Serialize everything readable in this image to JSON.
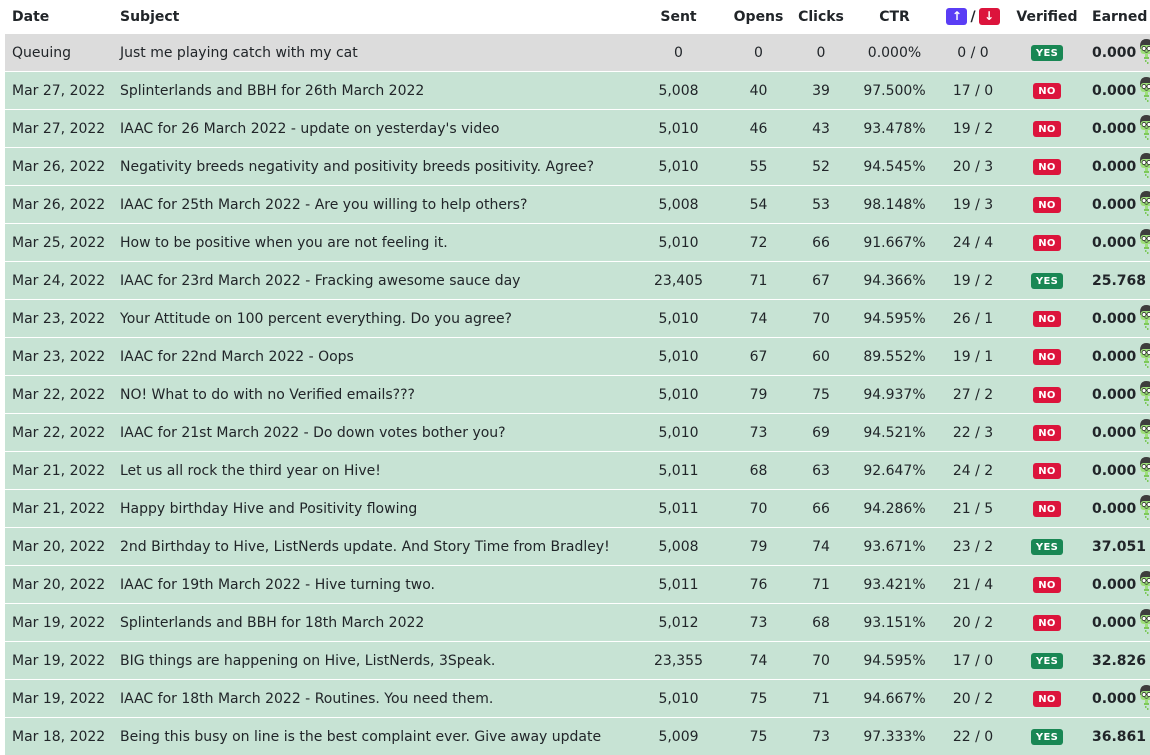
{
  "table": {
    "headers": {
      "date": "Date",
      "subject": "Subject",
      "sent": "Sent",
      "opens": "Opens",
      "clicks": "Clicks",
      "ctr": "CTR",
      "votes_sep": "/",
      "verified": "Verified",
      "earned": "Earned"
    },
    "rows": [
      {
        "status": "queued",
        "date": "Queuing",
        "subject": "Just me playing catch with my cat",
        "sent": "0",
        "opens": "0",
        "clicks": "0",
        "ctr": "0.000%",
        "votes": "0 / 0",
        "verified": "YES",
        "earned": "0.000"
      },
      {
        "status": "sent",
        "date": "Mar 27, 2022",
        "subject": "Splinterlands and BBH for 26th March 2022",
        "sent": "5,008",
        "opens": "40",
        "clicks": "39",
        "ctr": "97.500%",
        "votes": "17 / 0",
        "verified": "NO",
        "earned": "0.000"
      },
      {
        "status": "sent",
        "date": "Mar 27, 2022",
        "subject": "IAAC for 26 March 2022 - update on yesterday's video",
        "sent": "5,010",
        "opens": "46",
        "clicks": "43",
        "ctr": "93.478%",
        "votes": "19 / 2",
        "verified": "NO",
        "earned": "0.000"
      },
      {
        "status": "sent",
        "date": "Mar 26, 2022",
        "subject": "Negativity breeds negativity and positivity breeds positivity. Agree?",
        "sent": "5,010",
        "opens": "55",
        "clicks": "52",
        "ctr": "94.545%",
        "votes": "20 / 3",
        "verified": "NO",
        "earned": "0.000"
      },
      {
        "status": "sent",
        "date": "Mar 26, 2022",
        "subject": "IAAC for 25th March 2022 - Are you willing to help others?",
        "sent": "5,008",
        "opens": "54",
        "clicks": "53",
        "ctr": "98.148%",
        "votes": "19 / 3",
        "verified": "NO",
        "earned": "0.000"
      },
      {
        "status": "sent",
        "date": "Mar 25, 2022",
        "subject": "How to be positive when you are not feeling it.",
        "sent": "5,010",
        "opens": "72",
        "clicks": "66",
        "ctr": "91.667%",
        "votes": "24 / 4",
        "verified": "NO",
        "earned": "0.000"
      },
      {
        "status": "sent",
        "date": "Mar 24, 2022",
        "subject": "IAAC for 23rd March 2022 - Fracking awesome sauce day",
        "sent": "23,405",
        "opens": "71",
        "clicks": "67",
        "ctr": "94.366%",
        "votes": "19 / 2",
        "verified": "YES",
        "earned": "25.768"
      },
      {
        "status": "sent",
        "date": "Mar 23, 2022",
        "subject": "Your Attitude on 100 percent everything. Do you agree?",
        "sent": "5,010",
        "opens": "74",
        "clicks": "70",
        "ctr": "94.595%",
        "votes": "26 / 1",
        "verified": "NO",
        "earned": "0.000"
      },
      {
        "status": "sent",
        "date": "Mar 23, 2022",
        "subject": "IAAC for 22nd March 2022 - Oops",
        "sent": "5,010",
        "opens": "67",
        "clicks": "60",
        "ctr": "89.552%",
        "votes": "19 / 1",
        "verified": "NO",
        "earned": "0.000"
      },
      {
        "status": "sent",
        "date": "Mar 22, 2022",
        "subject": "NO! What to do with no Verified emails???",
        "sent": "5,010",
        "opens": "79",
        "clicks": "75",
        "ctr": "94.937%",
        "votes": "27 / 2",
        "verified": "NO",
        "earned": "0.000"
      },
      {
        "status": "sent",
        "date": "Mar 22, 2022",
        "subject": "IAAC for 21st March 2022 - Do down votes bother you?",
        "sent": "5,010",
        "opens": "73",
        "clicks": "69",
        "ctr": "94.521%",
        "votes": "22 / 3",
        "verified": "NO",
        "earned": "0.000"
      },
      {
        "status": "sent",
        "date": "Mar 21, 2022",
        "subject": "Let us all rock the third year on Hive!",
        "sent": "5,011",
        "opens": "68",
        "clicks": "63",
        "ctr": "92.647%",
        "votes": "24 / 2",
        "verified": "NO",
        "earned": "0.000"
      },
      {
        "status": "sent",
        "date": "Mar 21, 2022",
        "subject": "Happy birthday Hive and Positivity flowing",
        "sent": "5,011",
        "opens": "70",
        "clicks": "66",
        "ctr": "94.286%",
        "votes": "21 / 5",
        "verified": "NO",
        "earned": "0.000"
      },
      {
        "status": "sent",
        "date": "Mar 20, 2022",
        "subject": "2nd Birthday to Hive, ListNerds update. And Story Time from Bradley!",
        "sent": "5,008",
        "opens": "79",
        "clicks": "74",
        "ctr": "93.671%",
        "votes": "23 / 2",
        "verified": "YES",
        "earned": "37.051"
      },
      {
        "status": "sent",
        "date": "Mar 20, 2022",
        "subject": "IAAC for 19th March 2022 - Hive turning two.",
        "sent": "5,011",
        "opens": "76",
        "clicks": "71",
        "ctr": "93.421%",
        "votes": "21 / 4",
        "verified": "NO",
        "earned": "0.000"
      },
      {
        "status": "sent",
        "date": "Mar 19, 2022",
        "subject": "Splinterlands and BBH for 18th March 2022",
        "sent": "5,012",
        "opens": "73",
        "clicks": "68",
        "ctr": "93.151%",
        "votes": "20 / 2",
        "verified": "NO",
        "earned": "0.000"
      },
      {
        "status": "sent",
        "date": "Mar 19, 2022",
        "subject": "BIG things are happening on Hive, ListNerds, 3Speak.",
        "sent": "23,355",
        "opens": "74",
        "clicks": "70",
        "ctr": "94.595%",
        "votes": "17 / 0",
        "verified": "YES",
        "earned": "32.826"
      },
      {
        "status": "sent",
        "date": "Mar 19, 2022",
        "subject": "IAAC for 18th March 2022 - Routines. You need them.",
        "sent": "5,010",
        "opens": "75",
        "clicks": "71",
        "ctr": "94.667%",
        "votes": "20 / 2",
        "verified": "NO",
        "earned": "0.000"
      },
      {
        "status": "sent",
        "date": "Mar 18, 2022",
        "subject": "Being this busy on line is the best complaint ever. Give away update",
        "sent": "5,009",
        "opens": "75",
        "clicks": "73",
        "ctr": "97.333%",
        "votes": "22 / 0",
        "verified": "YES",
        "earned": "36.861"
      }
    ]
  },
  "icons": {
    "upvote": "arrow-up-icon",
    "downvote": "arrow-down-icon",
    "earned": "nerd-mascot-icon"
  },
  "colors": {
    "queued_row": "#dcdcdc",
    "sent_row": "#c7e3d4",
    "yes_badge": "#198754",
    "no_badge": "#dc143c",
    "upvote": "#5a3df5",
    "downvote": "#dc143c"
  }
}
